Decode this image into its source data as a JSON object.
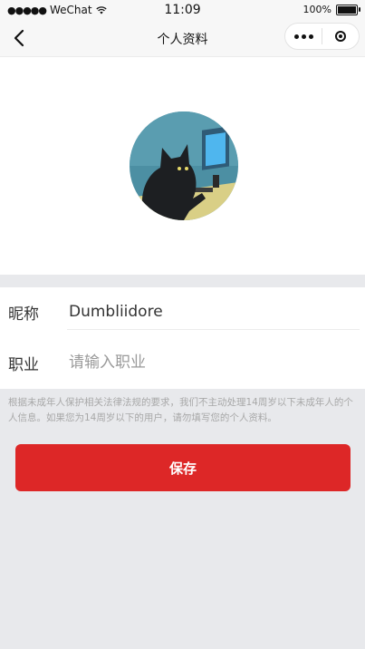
{
  "status_bar": {
    "carrier": "WeChat",
    "time": "11:09",
    "battery": "100%"
  },
  "nav": {
    "title": "个人资料",
    "back_icon": "chevron-left-icon",
    "more_icon": "more-dots-icon",
    "close_icon": "target-close-icon"
  },
  "avatar": {
    "description_icon": "cat-at-computer-avatar"
  },
  "form": {
    "nickname": {
      "label": "昵称",
      "value": "Dumbliidore"
    },
    "job": {
      "label": "职业",
      "placeholder": "请输入职业"
    }
  },
  "notice": "根据未成年人保护相关法律法规的要求，我们不主动处理14周岁以下未成年人的个人信息。如果您为14周岁以下的用户，请勿填写您的个人资料。",
  "save_label": "保存",
  "colors": {
    "accent": "#dd2727",
    "background": "#e8e9ec"
  }
}
